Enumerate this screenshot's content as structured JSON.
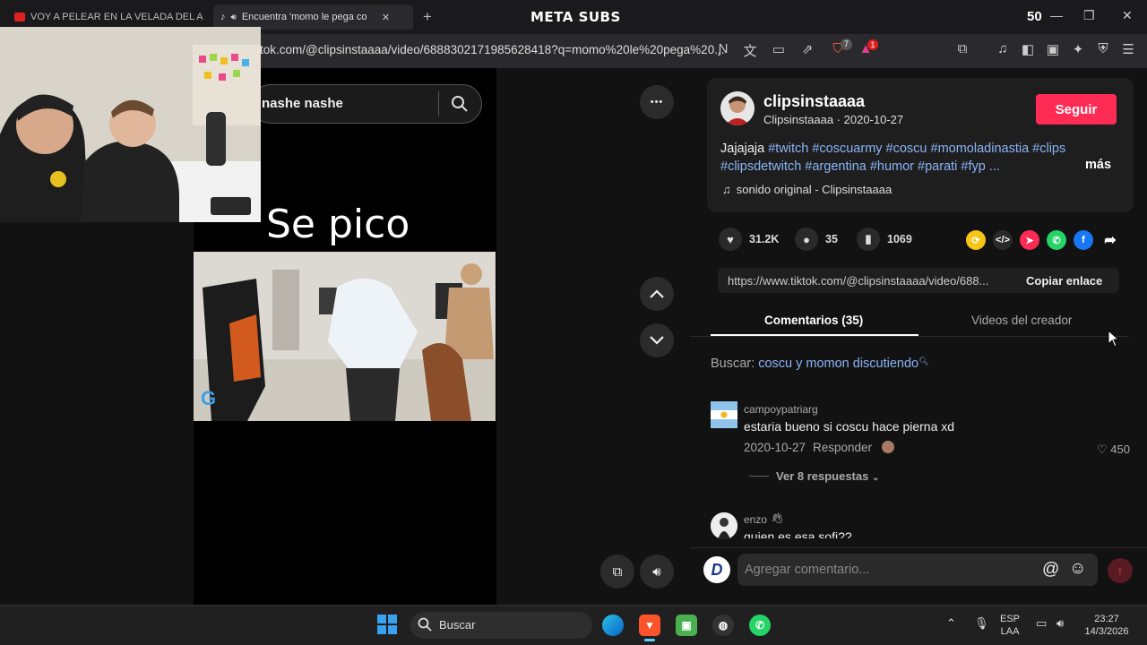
{
  "browser": {
    "tabs": [
      {
        "label": "VOY A PELEAR EN LA VELADA DEL A"
      },
      {
        "label": "Encuentra 'momo le pega co"
      }
    ],
    "url": "tok.com/@clipsinstaaaa/video/6888302171985628418?q=momo%20le%20pega%20...",
    "close_glyph": "✕",
    "new_tab_glyph": "+",
    "brave_badge": "7",
    "alert_badge": "1"
  },
  "overlay": {
    "brand": "META SUBS",
    "brand_number": "50"
  },
  "video": {
    "search_value": "nashe nashe",
    "caption": "Se pico",
    "watermark": "G",
    "more_glyph": "•••"
  },
  "post": {
    "username": "clipsinstaaaa",
    "display_name": "Clipsinstaaaa",
    "date": "2020-10-27",
    "follow_label": "Seguir",
    "desc_prefix": "Jajajaja",
    "hashtags_line1": "#twitch #coscuarmy #coscu #momoladinastia #clips",
    "hashtags_line2": "#clipsdetwitch #argentina #humor #parati #fyp ...",
    "more_label": "más",
    "sound": "sonido original - Clipsinstaaaa",
    "likes": "31.2K",
    "comments": "35",
    "saves": "1069",
    "link": "https://www.tiktok.com/@clipsinstaaaa/video/688...",
    "copy_label": "Copiar enlace"
  },
  "tabs": {
    "comments_label": "Comentarios (35)",
    "creator_label": "Videos del creador"
  },
  "search_suggestion": {
    "prefix": "Buscar:",
    "query": "coscu y momon discutiendo"
  },
  "comments": [
    {
      "user": "campoypatriarg",
      "text": "estaria bueno si coscu hace pierna xd",
      "date": "2020-10-27",
      "reply_label": "Responder",
      "likes": "450",
      "replies_label": "Ver 8 respuestas"
    },
    {
      "user": "enzo",
      "text": "quien es esa sofi??"
    }
  ],
  "comment_input": {
    "placeholder": "Agregar comentario...",
    "avatar_letter": "D"
  },
  "taskbar": {
    "search_label": "Buscar",
    "lang": "ESP",
    "region": "LAA",
    "time": "23:27",
    "date": "14/3/2026"
  },
  "colors": {
    "accent": "#fe2c55",
    "hashtag": "#8ab4f8"
  }
}
